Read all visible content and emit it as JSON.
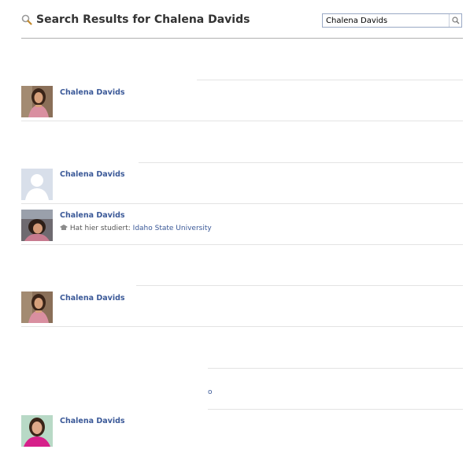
{
  "header": {
    "title": "Search Results for Chalena Davids",
    "search_value": "Chalena Davids"
  },
  "results": [
    {
      "name": "Chalena Davids"
    },
    {
      "name": "Chalena Davids"
    },
    {
      "name": "Chalena Davids",
      "detail_label": "Hat hier studiert:",
      "detail_link": "Idaho State University"
    },
    {
      "name": "Chalena Davids"
    },
    {
      "name": "Chalena Davids"
    }
  ],
  "fragment_text": "o",
  "colors": {
    "link": "#3b5998",
    "separator": "#e3e3e3"
  },
  "icons": [
    "search-icon",
    "default-avatar-icon",
    "school-icon"
  ]
}
